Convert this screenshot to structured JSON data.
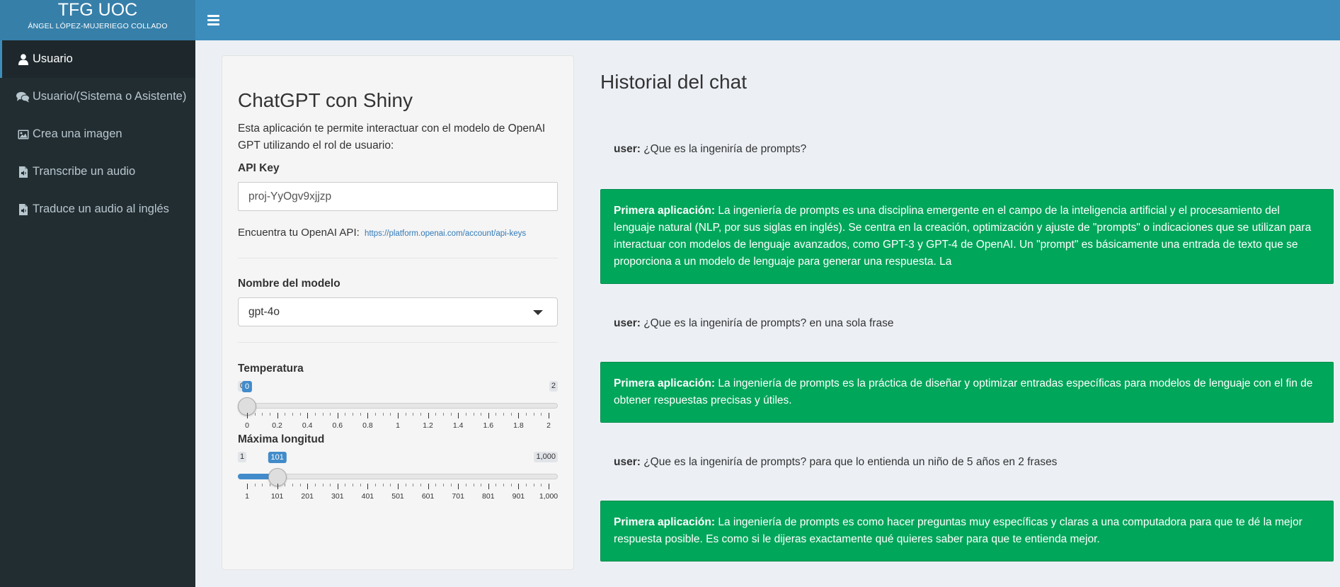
{
  "header": {
    "app_title": "TFG UOC",
    "app_subtitle": "ÁNGEL LÓPEZ-MUJERIEGO COLLADO",
    "menu_icon": "hamburger-icon"
  },
  "colors": {
    "header": "#3c8dbc",
    "logo": "#367fa9",
    "sidebar": "#222d32",
    "content_bg": "#ecf0f5",
    "assistant_bubble": "#00a65a",
    "slider_accent": "#428bca"
  },
  "sidebar": {
    "items": [
      {
        "label": "Usuario",
        "icon": "user-icon",
        "active": true
      },
      {
        "label": "Usuario/(Sistema o Asistente)",
        "icon": "comments-icon",
        "active": false
      },
      {
        "label": "Crea una imagen",
        "icon": "image-icon",
        "active": false
      },
      {
        "label": "Transcribe un audio",
        "icon": "file-audio-icon",
        "active": false
      },
      {
        "label": "Traduce un audio al inglés",
        "icon": "file-audio-icon",
        "active": false
      }
    ]
  },
  "panel": {
    "title": "ChatGPT con Shiny",
    "description": "Esta aplicación te permite interactuar con el modelo de OpenAI GPT utilizando el rol de usuario:",
    "api_key": {
      "label": "API Key",
      "value": "proj-YyOgv9xjjzp"
    },
    "help_text": "Encuentra tu OpenAI API:",
    "help_link": "https://platform.openai.com/account/api-keys",
    "model": {
      "label": "Nombre del modelo",
      "selected": "gpt-4o"
    },
    "temperature": {
      "label": "Temperatura",
      "min": 0,
      "max": 2,
      "value": 0,
      "min_label": "0",
      "max_label": "2",
      "value_label": "0",
      "ticks": [
        "0",
        "0.2",
        "0.4",
        "0.6",
        "0.8",
        "1",
        "1.2",
        "1.4",
        "1.6",
        "1.8",
        "2"
      ]
    },
    "max_length": {
      "label": "Máxima longitud",
      "min": 1,
      "max": 1000,
      "value": 101,
      "min_label": "1",
      "max_label": "1,000",
      "value_label": "101",
      "ticks": [
        "1",
        "101",
        "201",
        "301",
        "401",
        "501",
        "601",
        "701",
        "801",
        "901",
        "1,000"
      ]
    }
  },
  "chat": {
    "title": "Historial del chat",
    "messages": [
      {
        "role": "user:",
        "text": " ¿Que es la ingeniría de prompts?"
      },
      {
        "role": "Primera aplicación:",
        "text": " La ingeniería de prompts es una disciplina emergente en el campo de la inteligencia artificial y el procesamiento del lenguaje natural (NLP, por sus siglas en inglés). Se centra en la creación, optimización y ajuste de \"prompts\" o indicaciones que se utilizan para interactuar con modelos de lenguaje avanzados, como GPT-3 y GPT-4 de OpenAI. Un \"prompt\" es básicamente una entrada de texto que se proporciona a un modelo de lenguaje para generar una respuesta. La"
      },
      {
        "role": "user:",
        "text": " ¿Que es la ingeniría de prompts? en una sola frase"
      },
      {
        "role": "Primera aplicación:",
        "text": " La ingeniería de prompts es la práctica de diseñar y optimizar entradas específicas para modelos de lenguaje con el fin de obtener respuestas precisas y útiles."
      },
      {
        "role": "user:",
        "text": " ¿Que es la ingeniría de prompts? para que lo entienda un niño de 5 años en 2 frases"
      },
      {
        "role": "Primera aplicación:",
        "text": " La ingeniería de prompts es como hacer preguntas muy específicas y claras a una computadora para que te dé la mejor respuesta posible. Es como si le dijeras exactamente qué quieres saber para que te entienda mejor."
      }
    ]
  }
}
